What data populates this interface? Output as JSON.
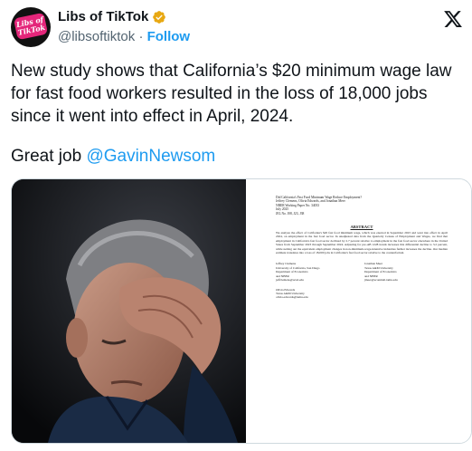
{
  "tweet": {
    "display_name": "Libs of TikTok",
    "handle": "@libsoftiktok",
    "separator": "·",
    "follow_label": "Follow",
    "avatar_text": [
      "Libs of",
      "TikTok"
    ],
    "text_lines": [
      "New study shows that California’s $20 minimum wage law",
      "for fast food workers resulted in the loss of 18,000 jobs",
      "since it went into effect in April, 2024."
    ],
    "extra_prefix": "Great job ",
    "mention": "@GavinNewsom"
  },
  "icons": {
    "verified": "verified-badge-icon",
    "platform": "x-logo-icon"
  },
  "colors": {
    "link": "#1d9bf0",
    "verified": "#e8a812",
    "text": "#0f1419",
    "muted": "#536471",
    "avatar_badge": "#e4267a"
  },
  "paper": {
    "title": "Did California's Fast Food Minimum Wage Reduce Employment?",
    "meta": [
      "Jeffrey Clemens, Olivia Edwards, and Jonathan Meer",
      "NBER Working Paper No. 34033",
      "July 2025",
      "JEL No. J08, J23, J38"
    ],
    "abstract_heading": "ABSTRACT",
    "abstract": "We analyze the effect of California's $20 fast food minimum wage, which was enacted in September 2023 and went into effect in April 2024, on employment in the fast food sector. In unadjusted data from the Quarterly Census of Employment and Wages, we find that employment in California's fast food sector declined by 2.7 percent relative to employment in the fast food sector elsewhere in the United States from September 2023 through September 2024. Adjusting for pre-AB 1228 trends increases this differential decline to 3.2 percent, while netting out the equivalent employment changes in non-minimum-wage-intensive industries further increases the decline. Our median estimate translates into a loss of 18,000 jobs in California's fast food sector relative to the counterfactual.",
    "author1": [
      "Jeffrey Clemens",
      "University of California, San Diego",
      "Department of Economics",
      "and NBER",
      "jeffclemens@ucsd.edu"
    ],
    "author2": [
      "Jonathan Meer",
      "Texas A&M University",
      "Department of Economics",
      "and NBER",
      "jmeer@econmail.tamu.edu"
    ],
    "author3": [
      "Olivia Edwards",
      "Texas A&M University",
      "olivia.edwards@tamu.edu"
    ]
  }
}
